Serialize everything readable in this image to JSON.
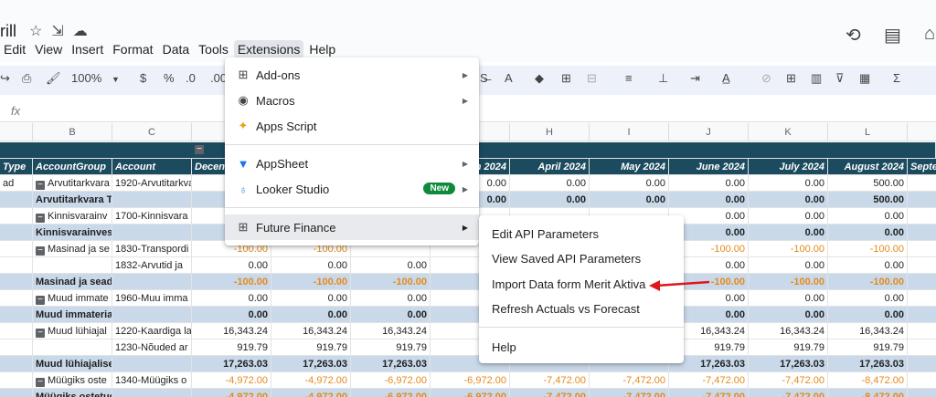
{
  "app": {
    "title_partial": "rill",
    "menu": [
      "Edit",
      "View",
      "Insert",
      "Format",
      "Data",
      "Tools",
      "Extensions",
      "Help"
    ],
    "active_menu": "Extensions"
  },
  "toolbar": {
    "zoom": "100%",
    "currency": "$",
    "percent": "%",
    "dec_decrease": ".0",
    "dec_increase": ".00",
    "fx": "fx"
  },
  "columns": [
    "B",
    "C",
    "H",
    "I",
    "J",
    "K",
    "L"
  ],
  "headers": {
    "type": "Type",
    "account_group": "AccountGroup",
    "account": "Account",
    "dec": "Decen",
    "mar": "h 2024",
    "apr": "April 2024",
    "may": "May 2024",
    "jun": "June 2024",
    "jul": "July 2024",
    "aug": "August 2024",
    "sep": "Septe"
  },
  "rows": [
    {
      "a": "ad",
      "b": "Arvutitarkvara",
      "c": "1920-Arvutitarkvar",
      "d": "",
      "e": "",
      "f": "",
      "g": "0.00",
      "h": "0.00",
      "i": "0.00",
      "j": "0.00",
      "k": "0.00",
      "l": "500.00",
      "type": "data"
    },
    {
      "a": "",
      "b": "Arvutitarkvara Total",
      "c": "",
      "d": "",
      "e": "",
      "f": "",
      "g": "0.00",
      "h": "0.00",
      "i": "0.00",
      "j": "0.00",
      "k": "0.00",
      "l": "500.00",
      "type": "total"
    },
    {
      "a": "",
      "b": "Kinnisvarainv",
      "c": "1700-Kinnisvara",
      "d": "",
      "e": "",
      "f": "",
      "g": "",
      "h": "",
      "i": "",
      "j": "0.00",
      "k": "0.00",
      "l": "0.00",
      "type": "data"
    },
    {
      "a": "",
      "b": "Kinnisvarainvesteeringud Total",
      "c": "",
      "d": "",
      "e": "",
      "f": "",
      "g": "",
      "h": "",
      "i": "",
      "j": "0.00",
      "k": "0.00",
      "l": "0.00",
      "type": "total"
    },
    {
      "a": "",
      "b": "Masinad ja se",
      "c": "1830-Transpordi",
      "d": "-100.00",
      "e": "-100.00",
      "f": "",
      "g": "",
      "h": "",
      "i": "",
      "j": "-100.00",
      "k": "-100.00",
      "l": "-100.00",
      "type": "data"
    },
    {
      "a": "",
      "b": "",
      "c": "1832-Arvutid ja",
      "d": "0.00",
      "e": "0.00",
      "f": "0.00",
      "g": "",
      "h": "",
      "i": "",
      "j": "0.00",
      "k": "0.00",
      "l": "0.00",
      "type": "data"
    },
    {
      "a": "",
      "b": "Masinad ja seadmed Total",
      "c": "",
      "d": "-100.00",
      "e": "-100.00",
      "f": "-100.00",
      "g": "",
      "h": "",
      "i": "",
      "j": "-100.00",
      "k": "-100.00",
      "l": "-100.00",
      "type": "total"
    },
    {
      "a": "",
      "b": "Muud immate",
      "c": "1960-Muu imma",
      "d": "0.00",
      "e": "0.00",
      "f": "0.00",
      "g": "",
      "h": "",
      "i": "",
      "j": "0.00",
      "k": "0.00",
      "l": "0.00",
      "type": "data"
    },
    {
      "a": "",
      "b": "Muud immateriaalsed põhivara",
      "c": "",
      "d": "0.00",
      "e": "0.00",
      "f": "0.00",
      "g": "",
      "h": "",
      "i": "",
      "j": "0.00",
      "k": "0.00",
      "l": "0.00",
      "type": "total"
    },
    {
      "a": "",
      "b": "Muud lühiajal",
      "c": "1220-Kaardiga la",
      "d": "16,343.24",
      "e": "16,343.24",
      "f": "16,343.24",
      "g": "",
      "h": "",
      "i": "",
      "j": "16,343.24",
      "k": "16,343.24",
      "l": "16,343.24",
      "type": "data"
    },
    {
      "a": "",
      "b": "",
      "c": "1230-Nõuded ar",
      "d": "919.79",
      "e": "919.79",
      "f": "919.79",
      "g": "9",
      "h": "",
      "i": "",
      "j": "919.79",
      "k": "919.79",
      "l": "919.79",
      "type": "data"
    },
    {
      "a": "",
      "b": "Muud lühiajalised nõuded Total",
      "c": "",
      "d": "17,263.03",
      "e": "17,263.03",
      "f": "17,263.03",
      "g": "",
      "h": "",
      "i": "",
      "j": "17,263.03",
      "k": "17,263.03",
      "l": "17,263.03",
      "type": "total"
    },
    {
      "a": "",
      "b": "Müügiks oste",
      "c": "1340-Müügiks o",
      "d": "-4,972.00",
      "e": "-4,972.00",
      "f": "-6,972.00",
      "g": "-6,972.00",
      "h": "-7,472.00",
      "i": "-7,472.00",
      "j": "-7,472.00",
      "k": "-7,472.00",
      "l": "-8,472.00",
      "type": "data"
    },
    {
      "a": "",
      "b": "Müügiks ostetud kaubad Total",
      "c": "",
      "d": "-4,972.00",
      "e": "-4,972.00",
      "f": "-6,972.00",
      "g": "-6,972.00",
      "h": "-7,472.00",
      "i": "-7,472.00",
      "j": "-7,472.00",
      "k": "-7,472.00",
      "l": "-8,472.00",
      "type": "total"
    }
  ],
  "extensions_menu": {
    "items": [
      {
        "label": "Add-ons",
        "icon": "addons-icon",
        "has_sub": true
      },
      {
        "label": "Macros",
        "icon": "macros-icon",
        "has_sub": true
      },
      {
        "label": "Apps Script",
        "icon": "apps-script-icon",
        "has_sub": false
      },
      {
        "label": "AppSheet",
        "icon": "appsheet-icon",
        "has_sub": true
      },
      {
        "label": "Looker Studio",
        "icon": "looker-studio-icon",
        "has_sub": true,
        "badge": "New"
      },
      {
        "label": "Future Finance",
        "icon": "future-finance-icon",
        "has_sub": true
      }
    ]
  },
  "submenu": {
    "items": [
      "Edit API Parameters",
      "View Saved API Parameters",
      "Import Data form Merit Aktiva",
      "Refresh Actuals vs Forecast",
      "Help"
    ]
  },
  "colors": {
    "header_bg": "#1c4a5e",
    "total_bg": "#c9d9ea",
    "negative": "#e48a1c",
    "arrow": "#e0161b",
    "badge": "#0f8a3c"
  }
}
